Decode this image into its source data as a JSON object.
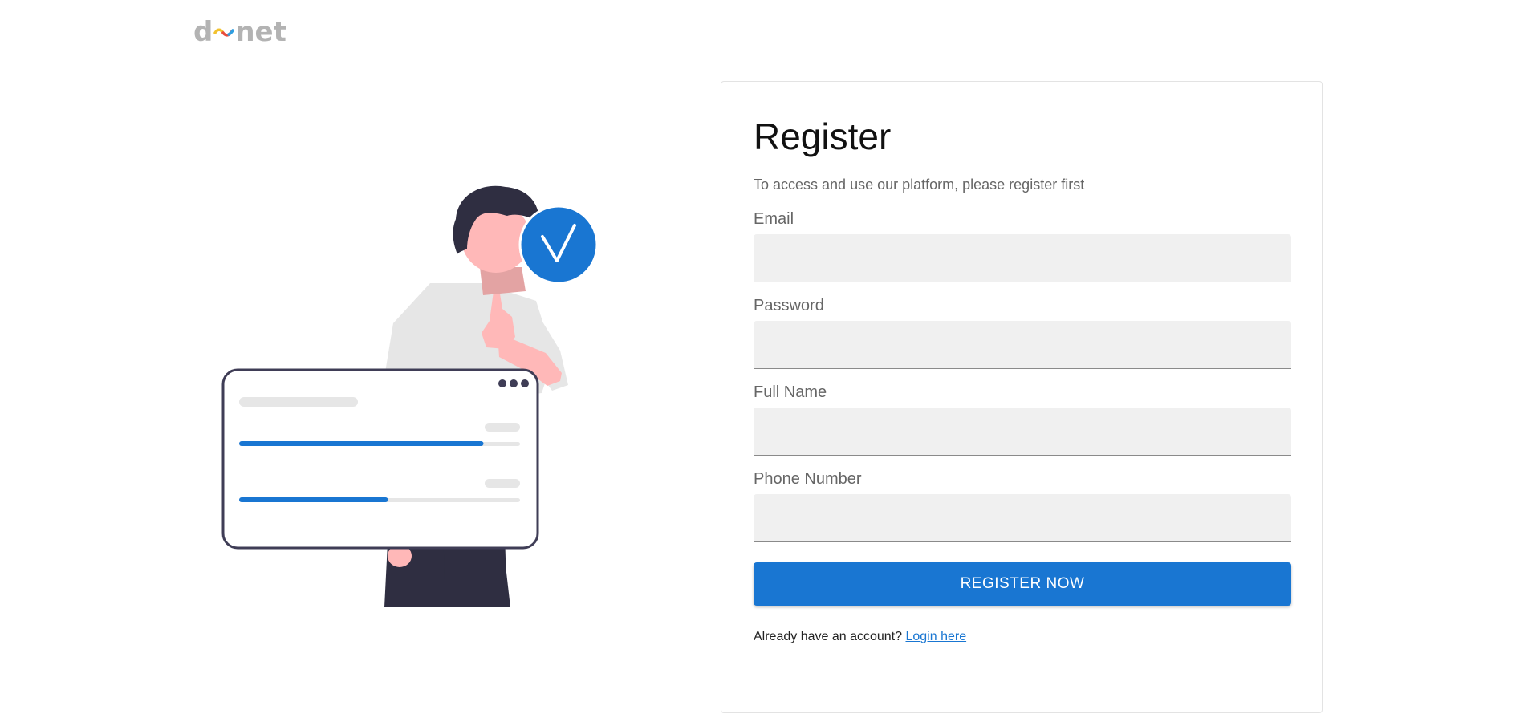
{
  "header": {
    "logo_text_left": "d",
    "logo_text_right": "net",
    "logo_colors": [
      "#b3b3b3",
      "#f2c230",
      "#e94b3c",
      "#2f9ee0"
    ]
  },
  "illustration": {
    "icon": "thumbs-up-check-illustration",
    "accent_color": "#1976d2",
    "progress_bars": [
      0.87,
      0.53
    ]
  },
  "form": {
    "title": "Register",
    "subtitle": "To access and use our platform, please register first",
    "fields": [
      {
        "label": "Email",
        "value": "",
        "placeholder": ""
      },
      {
        "label": "Password",
        "value": "",
        "placeholder": ""
      },
      {
        "label": "Full Name",
        "value": "",
        "placeholder": ""
      },
      {
        "label": "Phone Number",
        "value": "",
        "placeholder": ""
      }
    ],
    "submit_label": "REGISTER NOW",
    "login_prompt": "Already have an account?",
    "login_link": "Login here",
    "accent_color": "#1976d2"
  }
}
